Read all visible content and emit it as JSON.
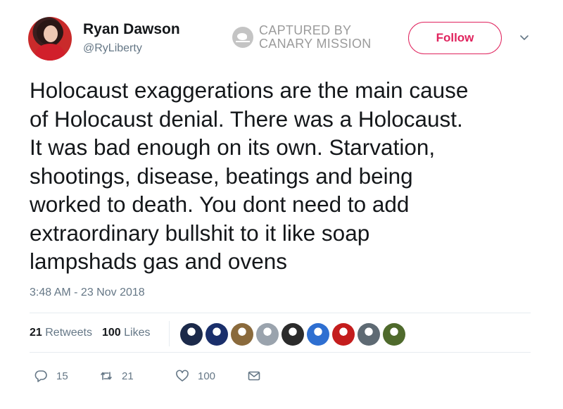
{
  "user": {
    "name": "Ryan Dawson",
    "handle": "@RyLiberty"
  },
  "watermark": {
    "line1": "CAPTURED BY",
    "line2": "CANARY MISSION"
  },
  "follow_label": "Follow",
  "tweet": {
    "text": "Holocaust exaggerations are the main cause\nof Holocaust denial. There  was a Holocaust.\nIt was bad enough on its own. Starvation,\nshootings,  disease, beatings and being\nworked to death. You dont need to add\nextraordinary bullshit to it like soap\nlampshads gas and ovens",
    "timestamp": "3:48 AM - 23 Nov 2018"
  },
  "stats": {
    "retweets_count": "21",
    "retweets_label": "Retweets",
    "likes_count": "100",
    "likes_label": "Likes"
  },
  "liker_avatars": [
    "#1c2a4a",
    "#1a2f6b",
    "#8a6a3c",
    "#9aa3ad",
    "#2b2b2b",
    "#2e6fd1",
    "#c41d1d",
    "#5e6a73",
    "#4f6a2c"
  ],
  "actions": {
    "reply_count": "15",
    "retweet_count": "21",
    "like_count": "100"
  },
  "colors": {
    "accent": "#e0245e",
    "muted": "#657786",
    "text": "#14171a"
  }
}
